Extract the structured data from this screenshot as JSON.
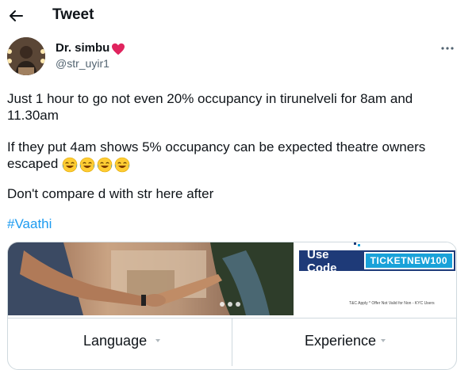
{
  "header": {
    "title": "Tweet",
    "back_icon": "arrow-left-icon"
  },
  "author": {
    "display_name": "Dr. simbu",
    "handle": "@str_uyir1",
    "badge_icon": "red-heart-icon",
    "badge_color": "#e0245e"
  },
  "tweet": {
    "paragraphs": [
      "Just 1 hour to go not even 20% occupancy in tirunelveli for 8am and 11.30am",
      "If they put 4am shows 5% occupancy can be expected theatre owners escaped",
      "Don't compare d with str here after"
    ],
    "emoji_icon": "face-with-tears-of-joy-icon",
    "emoji_count": 4,
    "hashtag": "#Vaathi",
    "hashtag_color": "#1d9bf0"
  },
  "card": {
    "promo": {
      "label": "Use Code",
      "code": "TICKETNEW100",
      "fineprint": "T&C Apply * Offer Not Valid for Non - KYC Users",
      "label_color": "#1e3a78",
      "code_color": "#1aa2d9"
    },
    "actions": [
      {
        "label": "Language",
        "icon": "caret-down-icon"
      },
      {
        "label": "Experience",
        "icon": "caret-down-icon"
      }
    ]
  },
  "menu": {
    "more_icon": "more-horizontal-icon"
  }
}
